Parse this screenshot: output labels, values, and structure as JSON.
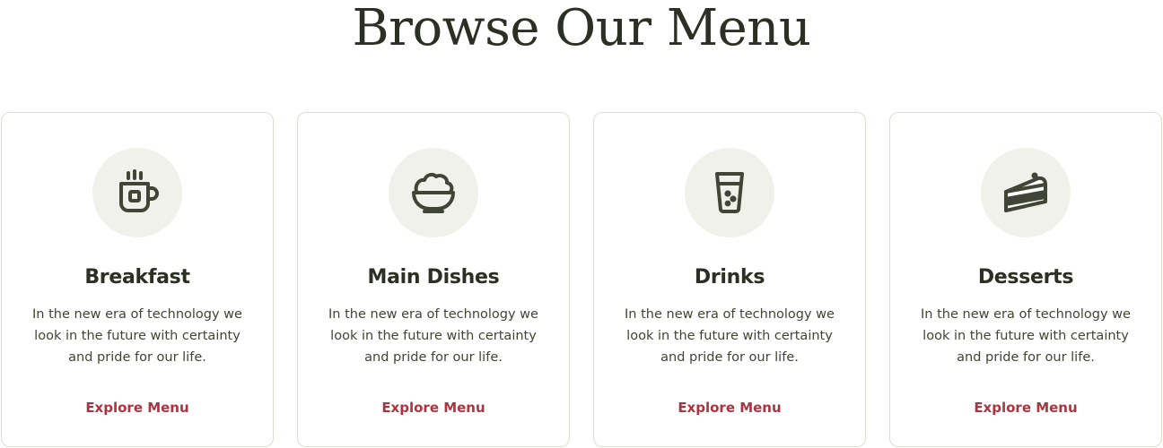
{
  "page": {
    "title": "Browse Our Menu"
  },
  "theme": {
    "heading_color": "#2C2F24",
    "text_color": "#414536",
    "accent_color": "#AD343E",
    "icon_bg_color": "#F1F1EC",
    "border_color": "#DBDFD0"
  },
  "cards": [
    {
      "icon": "coffee-cup-icon",
      "title": "Breakfast",
      "description": "In the new era of technology we look in the future with certainty and pride for our life.",
      "link_label": "Explore Menu"
    },
    {
      "icon": "rice-bowl-icon",
      "title": "Main Dishes",
      "description": "In the new era of technology we look in the future with certainty and pride for our life.",
      "link_label": "Explore Menu"
    },
    {
      "icon": "drink-glass-icon",
      "title": "Drinks",
      "description": "In the new era of technology we look in the future with certainty and pride for our life.",
      "link_label": "Explore Menu"
    },
    {
      "icon": "cake-slice-icon",
      "title": "Desserts",
      "description": "In the new era of technology we look in the future with certainty and pride for our life.",
      "link_label": "Explore Menu"
    }
  ]
}
